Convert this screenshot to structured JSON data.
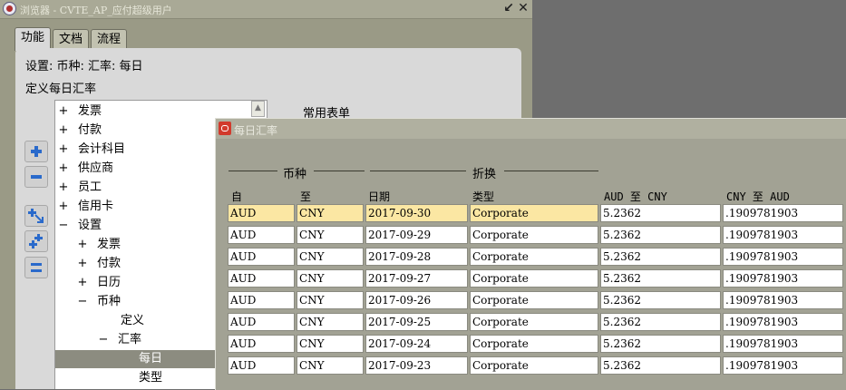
{
  "navigator": {
    "title": "浏览器 - CVTE_AP_应付超级用户",
    "tabs": [
      "功能",
      "文档",
      "流程"
    ],
    "breadcrumb": "设置: 币种: 汇率: 每日",
    "description": "定义每日汇率",
    "frequent_forms_label": "常用表单",
    "tree": [
      {
        "symbol": "+",
        "label": "发票",
        "level": 0
      },
      {
        "symbol": "+",
        "label": "付款",
        "level": 0
      },
      {
        "symbol": "+",
        "label": "会计科目",
        "level": 0
      },
      {
        "symbol": "+",
        "label": "供应商",
        "level": 0
      },
      {
        "symbol": "+",
        "label": "员工",
        "level": 0
      },
      {
        "symbol": "+",
        "label": "信用卡",
        "level": 0
      },
      {
        "symbol": "−",
        "label": "设置",
        "level": 0
      },
      {
        "symbol": "+",
        "label": "发票",
        "level": 1
      },
      {
        "symbol": "+",
        "label": "付款",
        "level": 1
      },
      {
        "symbol": "+",
        "label": "日历",
        "level": 1
      },
      {
        "symbol": "−",
        "label": "币种",
        "level": 1
      },
      {
        "symbol": "",
        "label": "定义",
        "level": 2
      },
      {
        "symbol": "−",
        "label": "汇率",
        "level": 2
      },
      {
        "symbol": "",
        "label": "每日",
        "level": 3,
        "selected": true
      },
      {
        "symbol": "",
        "label": "类型",
        "level": 3
      }
    ]
  },
  "rates_form": {
    "title": "每日汇率",
    "group_currency": "币种",
    "group_conversion": "折换",
    "headers": [
      "自",
      "至",
      "日期",
      "类型",
      "AUD 至 CNY",
      "CNY 至 AUD"
    ],
    "rows": [
      [
        "AUD",
        "CNY",
        "2017-09-30",
        "Corporate",
        "5.2362",
        ".1909781903"
      ],
      [
        "AUD",
        "CNY",
        "2017-09-29",
        "Corporate",
        "5.2362",
        ".1909781903"
      ],
      [
        "AUD",
        "CNY",
        "2017-09-28",
        "Corporate",
        "5.2362",
        ".1909781903"
      ],
      [
        "AUD",
        "CNY",
        "2017-09-27",
        "Corporate",
        "5.2362",
        ".1909781903"
      ],
      [
        "AUD",
        "CNY",
        "2017-09-26",
        "Corporate",
        "5.2362",
        ".1909781903"
      ],
      [
        "AUD",
        "CNY",
        "2017-09-25",
        "Corporate",
        "5.2362",
        ".1909781903"
      ],
      [
        "AUD",
        "CNY",
        "2017-09-24",
        "Corporate",
        "5.2362",
        ".1909781903"
      ],
      [
        "AUD",
        "CNY",
        "2017-09-23",
        "Corporate",
        "5.2362",
        ".1909781903"
      ]
    ]
  },
  "colors": {
    "current_record": "#fbe7a3",
    "selected_tree_node": "#8c8c80",
    "oracle_logo": "#d23a2c"
  },
  "icons": {
    "side_buttons": [
      "expand-icon",
      "collapse-icon",
      "expand-branch-icon",
      "expand-all-icon",
      "collapse-all-icon"
    ]
  }
}
